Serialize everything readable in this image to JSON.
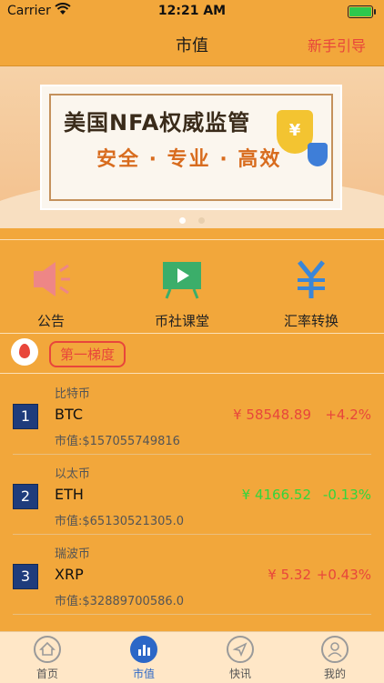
{
  "status": {
    "carrier": "Carrier",
    "time": "12:21 AM"
  },
  "nav": {
    "title": "市值",
    "guide": "新手引导"
  },
  "banner": {
    "headline": "美国NFA权威监管",
    "subline": "安全 · 专业 · 高效",
    "shield_symbol": "¥"
  },
  "quick": [
    {
      "label": "公告",
      "icon": "speaker-icon"
    },
    {
      "label": "币社课堂",
      "icon": "video-board-icon"
    },
    {
      "label": "汇率转换",
      "icon": "yen-exchange-icon"
    }
  ],
  "section": {
    "tier": "第一梯度"
  },
  "coins": [
    {
      "rank": "1",
      "cn": "比特币",
      "symbol": "BTC",
      "cap": "市值:$157055749816",
      "price": "¥ 58548.89",
      "change": "+4.2%",
      "up": true
    },
    {
      "rank": "2",
      "cn": "以太币",
      "symbol": "ETH",
      "cap": "市值:$65130521305.0",
      "price": "¥ 4166.52",
      "change": "-0.13%",
      "up": false
    },
    {
      "rank": "3",
      "cn": "瑞波币",
      "symbol": "XRP",
      "cap": "市值:$32889700586.0",
      "price": "¥ 5.32",
      "change": "+0.43%",
      "up": true
    }
  ],
  "tabs": [
    {
      "label": "首页",
      "icon": "home-icon"
    },
    {
      "label": "市值",
      "icon": "bar-chart-icon"
    },
    {
      "label": "快讯",
      "icon": "send-icon"
    },
    {
      "label": "我的",
      "icon": "user-icon"
    }
  ],
  "colors": {
    "accent": "#F2A73B",
    "up": "#E8463B",
    "down": "#31D63C",
    "active_tab": "#2B67C7"
  }
}
